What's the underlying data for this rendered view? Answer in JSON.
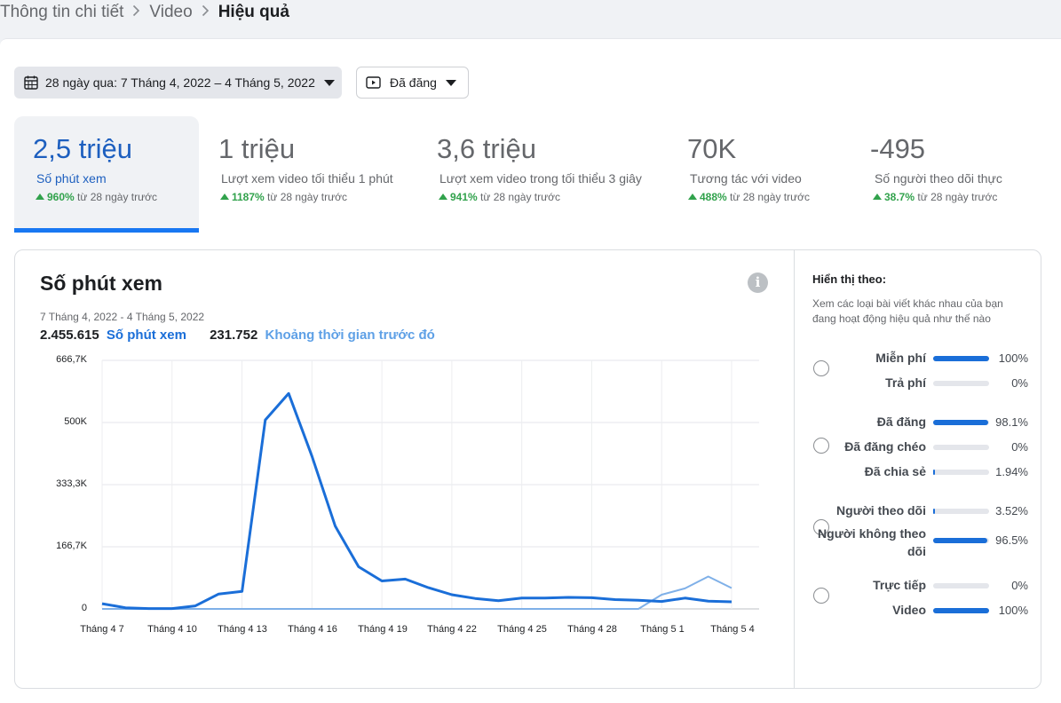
{
  "breadcrumb": {
    "items": [
      "Thông tin chi tiết",
      "Video",
      "Hiệu quả"
    ]
  },
  "filters": {
    "date_range": "28 ngày qua: 7 Tháng 4, 2022 – 4 Tháng 5, 2022",
    "status": "Đã đăng"
  },
  "metrics": [
    {
      "value": "2,5 triệu",
      "label": "Số phút xem",
      "change": "960%",
      "change_suffix": "từ 28 ngày trước"
    },
    {
      "value": "1 triệu",
      "label": "Lượt xem video tối thiểu 1 phút",
      "change": "1187%",
      "change_suffix": "từ 28 ngày trước"
    },
    {
      "value": "3,6 triệu",
      "label": "Lượt xem video trong tối thiểu 3 giây",
      "change": "941%",
      "change_suffix": "từ 28 ngày trước"
    },
    {
      "value": "70K",
      "label": "Tương tác với video",
      "change": "488%",
      "change_suffix": "từ 28 ngày trước"
    },
    {
      "value": "-495",
      "label": "Số người theo dõi thực",
      "change": "38.7%",
      "change_suffix": "từ 28 ngày trước"
    }
  ],
  "chart_section": {
    "title": "Số phút xem",
    "date_range": "7 Tháng 4, 2022 - 4 Tháng 5, 2022",
    "current_total": "2.455.615",
    "current_label": "Số phút xem",
    "previous_total": "231.752",
    "previous_label": "Khoảng thời gian trước đó",
    "info_icon": "i"
  },
  "chart_data": {
    "type": "line",
    "x": [
      "Tháng 4 7",
      "Tháng 4 8",
      "Tháng 4 9",
      "Tháng 4 10",
      "Tháng 4 11",
      "Tháng 4 12",
      "Tháng 4 13",
      "Tháng 4 14",
      "Tháng 4 15",
      "Tháng 4 16",
      "Tháng 4 17",
      "Tháng 4 18",
      "Tháng 4 19",
      "Tháng 4 20",
      "Tháng 4 21",
      "Tháng 4 22",
      "Tháng 4 23",
      "Tháng 4 24",
      "Tháng 4 25",
      "Tháng 4 26",
      "Tháng 4 27",
      "Tháng 4 28",
      "Tháng 4 29",
      "Tháng 4 30",
      "Tháng 5 1",
      "Tháng 5 2",
      "Tháng 5 3",
      "Tháng 5 4"
    ],
    "x_tick_labels": [
      "Tháng 4 7",
      "Tháng 4 10",
      "Tháng 4 13",
      "Tháng 4 16",
      "Tháng 4 19",
      "Tháng 4 22",
      "Tháng 4 25",
      "Tháng 4 28",
      "Tháng 5 1",
      "Tháng 5 4"
    ],
    "series": [
      {
        "name": "Số phút xem",
        "color": "#1a6ed8",
        "values": [
          14000,
          3000,
          1000,
          1000,
          8000,
          40000,
          47000,
          507000,
          578000,
          410000,
          222000,
          113000,
          75000,
          80000,
          57000,
          38000,
          28000,
          22000,
          29000,
          29000,
          31000,
          30000,
          25000,
          23000,
          20000,
          29000,
          21000,
          19000
        ]
      },
      {
        "name": "Khoảng thời gian trước đó",
        "color": "#7fb0e8",
        "values": [
          0,
          0,
          0,
          0,
          0,
          0,
          0,
          0,
          0,
          0,
          0,
          0,
          0,
          0,
          0,
          0,
          0,
          0,
          0,
          0,
          0,
          0,
          0,
          0,
          38000,
          55000,
          87000,
          56000
        ]
      }
    ],
    "y_tick_labels": [
      "666,7K",
      "500K",
      "333,3K",
      "166,7K",
      "0"
    ],
    "y_ticks": [
      666700,
      500000,
      333300,
      166700,
      0
    ],
    "ylim": [
      0,
      666700
    ],
    "grid": true
  },
  "breakdown": {
    "title": "Hiển thị theo:",
    "description": "Xem các loại bài viết khác nhau của bạn đang hoạt động hiệu quả như thế nào",
    "groups": [
      {
        "rows": [
          {
            "label": "Miễn phí",
            "pct": "100%",
            "fraction": 1.0
          },
          {
            "label": "Trả phí",
            "pct": "0%",
            "fraction": 0.0
          }
        ]
      },
      {
        "rows": [
          {
            "label": "Đã đăng",
            "pct": "98.1%",
            "fraction": 0.981
          },
          {
            "label": "Đã đăng chéo",
            "pct": "0%",
            "fraction": 0.0
          },
          {
            "label": "Đã chia sẻ",
            "pct": "1.94%",
            "fraction": 0.0194
          }
        ]
      },
      {
        "rows": [
          {
            "label": "Người theo dõi",
            "pct": "3.52%",
            "fraction": 0.0352
          },
          {
            "label": "Người không theo dõi",
            "pct": "96.5%",
            "fraction": 0.965
          }
        ]
      },
      {
        "rows": [
          {
            "label": "Trực tiếp",
            "pct": "0%",
            "fraction": 0.0
          },
          {
            "label": "Video",
            "pct": "100%",
            "fraction": 1.0
          }
        ]
      }
    ]
  }
}
